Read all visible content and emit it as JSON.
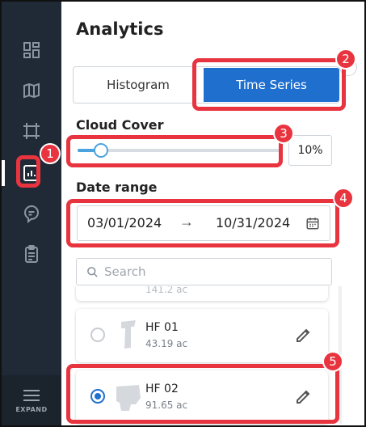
{
  "panel": {
    "title": "Analytics"
  },
  "tabs": {
    "histogram": "Histogram",
    "time_series": "Time Series",
    "active": "Time Series"
  },
  "cloud_cover": {
    "label": "Cloud Cover",
    "value_text": "10%",
    "value": 10
  },
  "date_range": {
    "label": "Date range",
    "start": "03/01/2024",
    "arrow": "→",
    "end": "10/31/2024"
  },
  "search": {
    "placeholder": "Search"
  },
  "fields": [
    {
      "name": "HF 01",
      "area": "43.19 ac",
      "selected": false
    },
    {
      "name": "HF 02",
      "area": "91.65 ac",
      "selected": true
    }
  ],
  "partial_field": {
    "area": "141.2 ac"
  },
  "sidebar": {
    "items": [
      "dashboard-icon",
      "map-icon",
      "crop-icon",
      "analytics-icon",
      "chat-icon",
      "clipboard-icon"
    ],
    "active": "analytics-icon",
    "expand_label": "EXPAND"
  },
  "steps": [
    "1",
    "2",
    "3",
    "4",
    "5"
  ],
  "colors": {
    "accent": "#1f6fcf",
    "highlight": "#e8343f",
    "sidebar_bg": "#202a36",
    "slider": "#4aa3df"
  }
}
